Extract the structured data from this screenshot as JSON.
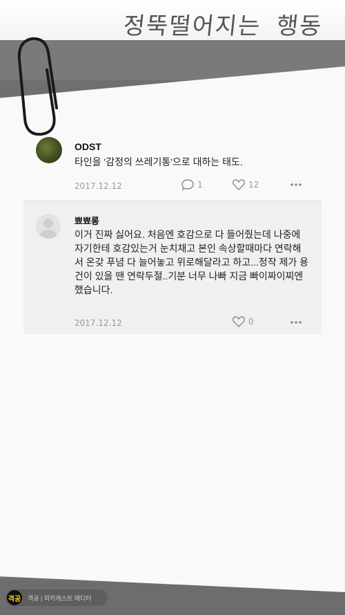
{
  "header": {
    "title": "정뚝떨어지는 행동"
  },
  "post": {
    "author": "ODST",
    "content": "타인을 '감정의 쓰레기통'으로 대하는 태도.",
    "date": "2017.12.12",
    "comment_count": "1",
    "like_count": "12"
  },
  "reply": {
    "author": "뾰뾰롱",
    "text": "이거 진짜 싫어요. 처음엔 호감으로 다 들어줬는데 나중에 자기한테 호감있는거 눈치채고 본인 속상할때마다 연락해서 온갖 푸념 다 늘어놓고 위로해달라고 하고...정작 제가 용건이 있을 땐 연락두절..기분 너무 나빠 지금 빠이짜이찌엔 했습니다.",
    "date": "2017.12.12",
    "like_count": "0"
  },
  "footer": {
    "logo": "격공",
    "text": "격공 | 피키캐스트 에디터"
  },
  "colors": {
    "background": "#6f6f6f",
    "paper": "#f9f9f9",
    "meta_text": "#999999",
    "logo_yellow": "#f3d000"
  },
  "icons": [
    "paperclip-icon",
    "comment-icon",
    "heart-icon",
    "more-icon",
    "default-avatar-icon"
  ]
}
